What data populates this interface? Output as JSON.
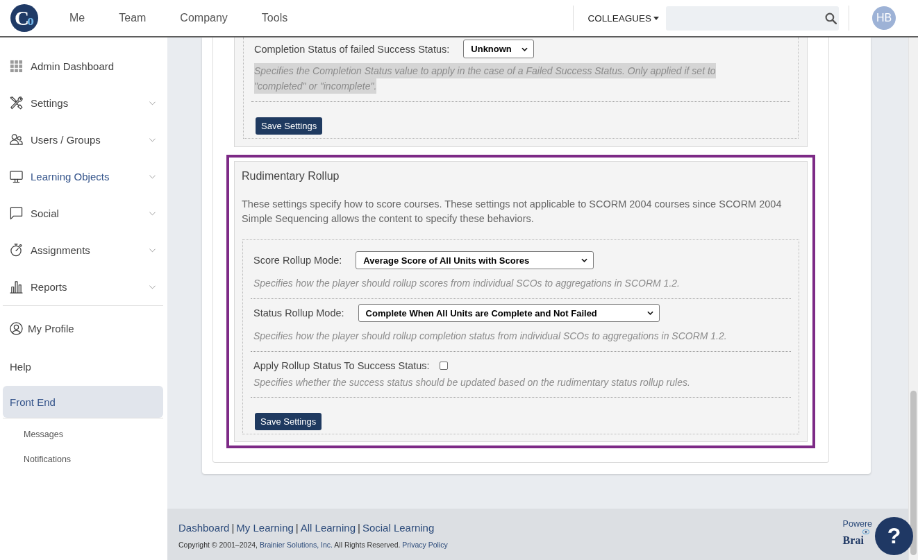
{
  "header": {
    "logo": "Co",
    "nav": [
      {
        "label": "Me"
      },
      {
        "label": "Team"
      },
      {
        "label": "Company"
      },
      {
        "label": "Tools"
      }
    ],
    "colleagues_menu": "COLLEAGUES",
    "avatar": "HB"
  },
  "sidebar": {
    "sections": [
      {
        "items": [
          {
            "label": "Admin Dashboard",
            "kind": "icon",
            "expandable": false,
            "active": false,
            "selected": false
          },
          {
            "label": "Settings",
            "kind": "icon",
            "expandable": true,
            "active": false,
            "selected": false
          },
          {
            "label": "Users / Groups",
            "kind": "icon",
            "expandable": true,
            "active": false,
            "selected": false
          },
          {
            "label": "Learning Objects",
            "kind": "icon",
            "expandable": true,
            "active": true,
            "selected": false
          },
          {
            "label": "Social",
            "kind": "icon",
            "expandable": true,
            "active": false,
            "selected": false
          },
          {
            "label": "Assignments",
            "kind": "icon",
            "expandable": true,
            "active": false,
            "selected": false
          },
          {
            "label": "Reports",
            "kind": "icon",
            "expandable": true,
            "active": false,
            "selected": false
          }
        ]
      },
      {
        "items": [
          {
            "label": "My Profile",
            "kind": "icon",
            "expandable": false,
            "active": false,
            "selected": false
          },
          {
            "label": "Help",
            "kind": "text",
            "expandable": false,
            "active": false,
            "selected": false
          },
          {
            "label": "Front End",
            "kind": "text",
            "expandable": false,
            "active": true,
            "selected": true
          }
        ]
      },
      {
        "items": [
          {
            "label": "Messages",
            "kind": "sub",
            "expandable": false,
            "active": false,
            "selected": false
          },
          {
            "label": "Notifications",
            "kind": "sub",
            "expandable": false,
            "active": false,
            "selected": false
          }
        ]
      }
    ]
  },
  "content": {
    "sections": [
      {
        "highlighted": false,
        "fields": [
          {
            "kind": "select",
            "label": "Completion Status of failed Success Status:",
            "value": "Unknown",
            "help": "Specifies the Completion Status value to apply in the case of a Failed Success Status. Only applied if set to \"completed\" or \"incomplete\".",
            "help_selected": true
          }
        ],
        "button": "Save Settings"
      },
      {
        "highlighted": true,
        "title": "Rudimentary Rollup",
        "description": "These settings specify how to score courses. These settings not applicable to SCORM 2004 courses since SCORM 2004 Simple Sequencing allows the content to specify these behaviors.",
        "fields": [
          {
            "kind": "select",
            "label": "Score Rollup Mode:",
            "value": "Average Score of All Units with Scores",
            "help": "Specifies how the player should rollup scores from individual SCOs to aggregations in SCORM 1.2.",
            "help_selected": false
          },
          {
            "kind": "select",
            "label": "Status Rollup Mode:",
            "value": "Complete When All Units are Complete and Not Failed",
            "help": "Specifies how the player should rollup completion status from individual SCOs to aggregations in SCORM 1.2.",
            "help_selected": false
          },
          {
            "kind": "checkbox",
            "label": "Apply Rollup Status To Success Status:",
            "checked": false,
            "help": "Specifies whether the success status should be updated based on the rudimentary status rollup rules.",
            "help_selected": false
          }
        ],
        "button": "Save Settings"
      }
    ]
  },
  "footer": {
    "links": [
      "Dashboard",
      "My Learning",
      "All Learning",
      "Social Learning"
    ],
    "separator": "|",
    "copyright": {
      "before": "Copyright © 2001–2024,",
      "company_link": "Brainier Solutions, Inc.",
      "after": "All Rights Reserved.",
      "policy_link": "Privacy Policy"
    },
    "powered_by": "Powere",
    "brand": "Brai"
  },
  "help_button": "?"
}
